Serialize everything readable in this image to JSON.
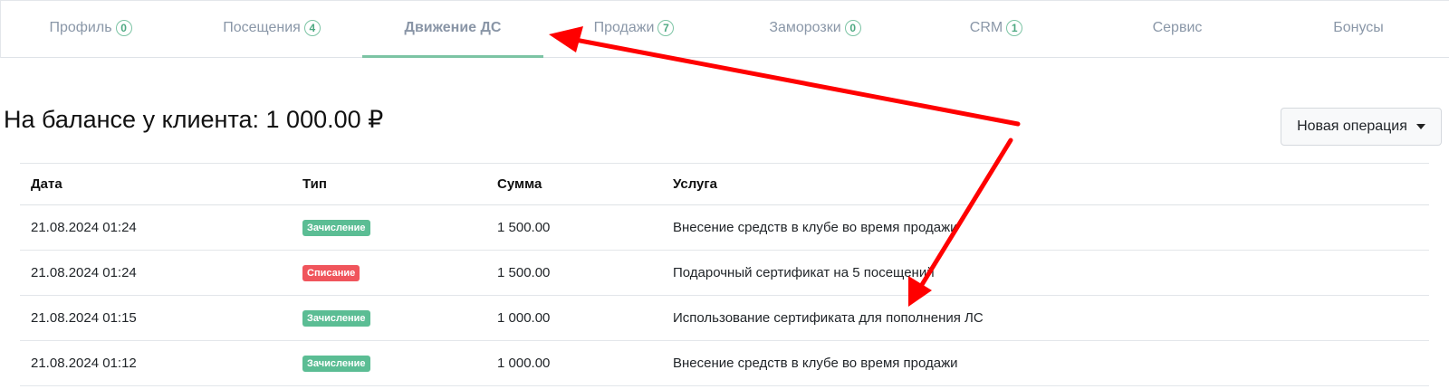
{
  "tabs": [
    {
      "label": "Профиль",
      "count": "0"
    },
    {
      "label": "Посещения",
      "count": "4"
    },
    {
      "label": "Движение ДС",
      "count": null
    },
    {
      "label": "Продажи",
      "count": "7"
    },
    {
      "label": "Заморозки",
      "count": "0"
    },
    {
      "label": "CRM",
      "count": "1"
    },
    {
      "label": "Сервис",
      "count": null
    },
    {
      "label": "Бонусы",
      "count": null
    }
  ],
  "active_tab": "Движение ДС",
  "balance": {
    "text": "На балансе у клиента: 1 000.00 ₽"
  },
  "new_operation_button": {
    "label": "Новая операция"
  },
  "table": {
    "headers": {
      "date": "Дата",
      "type": "Тип",
      "amount": "Сумма",
      "service": "Услуга"
    },
    "rows": [
      {
        "date": "21.08.2024 01:24",
        "type": "Зачисление",
        "type_kind": "credit",
        "amount": "1 500.00",
        "service": "Внесение средств в клубе во время продажи"
      },
      {
        "date": "21.08.2024 01:24",
        "type": "Списание",
        "type_kind": "debit",
        "amount": "1 500.00",
        "service": "Подарочный сертификат на 5 посещений"
      },
      {
        "date": "21.08.2024 01:15",
        "type": "Зачисление",
        "type_kind": "credit",
        "amount": "1 000.00",
        "service": "Использование сертификата для пополнения ЛС"
      },
      {
        "date": "21.08.2024 01:12",
        "type": "Зачисление",
        "type_kind": "credit",
        "amount": "1 000.00",
        "service": "Внесение средств в клубе во время продажи"
      }
    ]
  },
  "colors": {
    "accent_green": "#7cc4a4",
    "badge_credit": "#5bbd94",
    "badge_debit": "#f0555c",
    "annotation_arrow": "#ff0000"
  }
}
